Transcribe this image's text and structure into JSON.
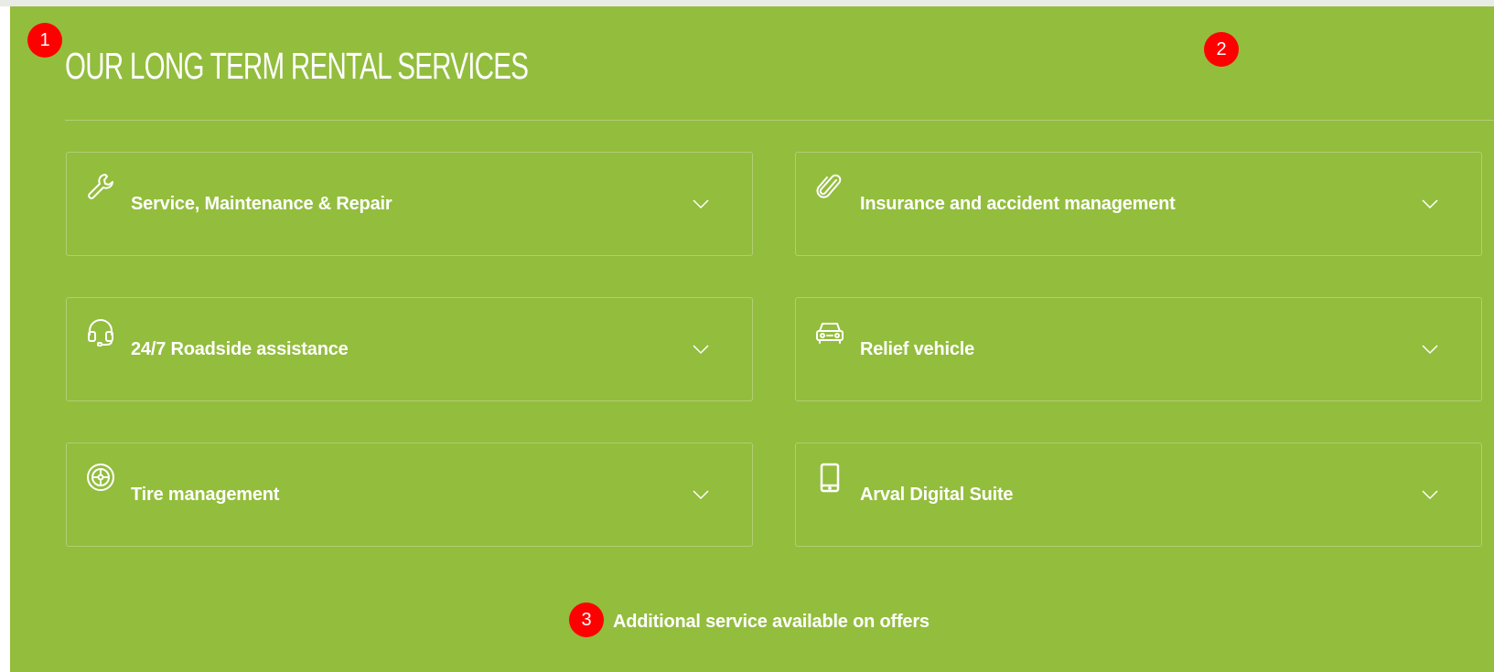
{
  "section": {
    "title": "OUR LONG TERM RENTAL SERVICES",
    "footnote": "Additional service available on offers",
    "background_color": "#93bd3d"
  },
  "services": [
    {
      "label": "Service, Maintenance & Repair",
      "icon": "wrench-icon"
    },
    {
      "label": "Insurance and accident management",
      "icon": "paperclip-icon"
    },
    {
      "label": "24/7 Roadside assistance",
      "icon": "headset-icon"
    },
    {
      "label": "Relief vehicle",
      "icon": "car-icon"
    },
    {
      "label": "Tire management",
      "icon": "tire-icon"
    },
    {
      "label": "Arval Digital Suite",
      "icon": "smartphone-icon"
    }
  ],
  "markers": [
    "1",
    "2",
    "3"
  ]
}
